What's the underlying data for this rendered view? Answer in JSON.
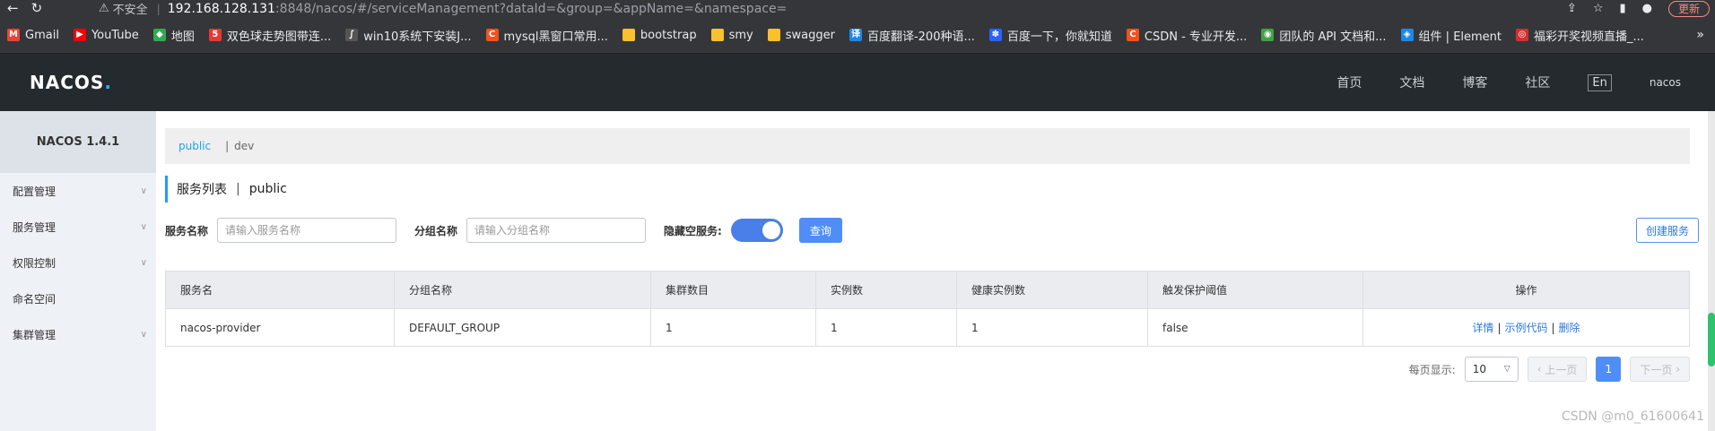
{
  "browser": {
    "insecure_label": "不安全",
    "url_host": "192.168.128.131",
    "url_path": ":8848/nacos/#/serviceManagement?dataId=&group=&appName=&namespace=",
    "update_label": "更新"
  },
  "bookmarks": [
    {
      "label": "Gmail",
      "color": "#ea4335",
      "glyph": "M"
    },
    {
      "label": "YouTube",
      "color": "#ff0000",
      "glyph": "▶"
    },
    {
      "label": "地图",
      "color": "#34a853",
      "glyph": "◆"
    },
    {
      "label": "双色球走势图带连...",
      "color": "#e53935",
      "glyph": "5"
    },
    {
      "label": "win10系统下安装J...",
      "color": "#555555",
      "glyph": "∫"
    },
    {
      "label": "mysql黑窗口常用...",
      "color": "#f4511e",
      "glyph": "C"
    },
    {
      "label": "bootstrap",
      "color": "#fbc02d",
      "glyph": ""
    },
    {
      "label": "smy",
      "color": "#fbc02d",
      "glyph": ""
    },
    {
      "label": "swagger",
      "color": "#fbc02d",
      "glyph": ""
    },
    {
      "label": "百度翻译-200种语...",
      "color": "#1e88e5",
      "glyph": "译"
    },
    {
      "label": "百度一下，你就知道",
      "color": "#2962ff",
      "glyph": "✽"
    },
    {
      "label": "CSDN - 专业开发...",
      "color": "#f4511e",
      "glyph": "C"
    },
    {
      "label": "团队的 API 文档和...",
      "color": "#43a047",
      "glyph": "◉"
    },
    {
      "label": "组件 | Element",
      "color": "#1e88e5",
      "glyph": "◈"
    },
    {
      "label": "福彩开奖视频直播_...",
      "color": "#d32f2f",
      "glyph": "◎"
    }
  ],
  "header": {
    "logo": "NACOS",
    "nav": [
      "首页",
      "文档",
      "博客",
      "社区"
    ],
    "lang": "En",
    "user": "nacos"
  },
  "sidebar": {
    "version": "NACOS 1.4.1",
    "items": [
      {
        "label": "配置管理",
        "has_chevron": true
      },
      {
        "label": "服务管理",
        "has_chevron": true
      },
      {
        "label": "权限控制",
        "has_chevron": true
      },
      {
        "label": "命名空间",
        "has_chevron": false
      },
      {
        "label": "集群管理",
        "has_chevron": true
      }
    ]
  },
  "namespace_bar": {
    "active": "public",
    "other": "dev"
  },
  "title": {
    "main": "服务列表",
    "namespace": "public"
  },
  "filters": {
    "service_name_label": "服务名称",
    "service_name_placeholder": "请输入服务名称",
    "group_name_label": "分组名称",
    "group_name_placeholder": "请输入分组名称",
    "hide_empty_label": "隐藏空服务:",
    "query_label": "查询",
    "create_label": "创建服务"
  },
  "table": {
    "columns": [
      "服务名",
      "分组名称",
      "集群数目",
      "实例数",
      "健康实例数",
      "触发保护阈值",
      "操作"
    ],
    "rows": [
      {
        "service": "nacos-provider",
        "group": "DEFAULT_GROUP",
        "clusters": "1",
        "instances": "1",
        "healthy": "1",
        "threshold": "false"
      }
    ],
    "ops": [
      "详情",
      "示例代码",
      "删除"
    ]
  },
  "pager": {
    "page_size_label": "每页显示:",
    "page_size": "10",
    "prev": "上一页",
    "next": "下一页",
    "current": "1"
  },
  "watermark": "CSDN @m0_61600641"
}
